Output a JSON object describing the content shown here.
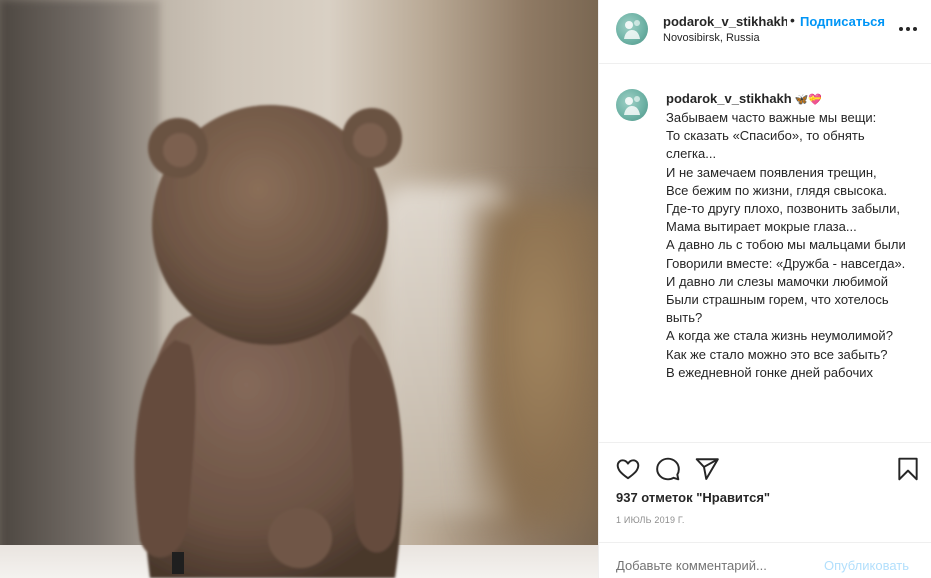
{
  "post": {
    "username": "podarok_v_stikhakh",
    "follow_label": "Подписаться",
    "separator": "•",
    "location": "Novosibirsk, Russia",
    "caption_emoji": "🦋💝",
    "caption_lines": [
      "Забываем часто важные мы вещи:",
      "То сказать «Спасибо», то обнять слегка...",
      "И не замечаем появления трещин,",
      "Все бежим по жизни, глядя свысока.",
      "Где-то другу плохо, позвонить забыли,",
      "Мама вытирает мокрые глаза...",
      "А давно ль с тобою мы мальцами были",
      "Говорили вместе: «Дружба - навсегда».",
      "И давно ли слезы мамочки любимой",
      "Были страшным горем, что хотелось выть?",
      "А когда же стала жизнь неумолимой?",
      "Как же стало можно это все забыть?",
      "В ежедневной гонке дней рабочих"
    ],
    "likes_text": "937 отметок \"Нравится\"",
    "date": "1 июль 2019 г.",
    "comment_placeholder": "Добавьте комментарий...",
    "publish_label": "Опубликовать",
    "colors": {
      "link": "#0095f6",
      "publish_disabled": "#b2dffc",
      "muted": "#8e8e8e",
      "text": "#262626"
    }
  }
}
